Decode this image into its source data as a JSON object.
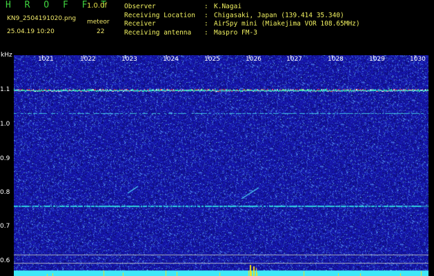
{
  "header": {
    "app_title": "H R O F F T",
    "version": "1.0.0f",
    "filename": "KN9_2504191020.png",
    "meteor_label": "meteor",
    "datetime": "25.04.19 10:20",
    "count": "22"
  },
  "info": [
    {
      "key": "Observer",
      "sep": ":",
      "value": "K.Nagai"
    },
    {
      "key": "Receiving Location",
      "sep": ":",
      "value": "Chigasaki, Japan (139.414 35.340)"
    },
    {
      "key": "Receiver",
      "sep": ":",
      "value": "AirSpy mini (Miakejima VOR 108.65MHz)"
    },
    {
      "key": "Receiving antenna",
      "sep": ":",
      "value": "Maspro FM-3"
    }
  ],
  "axis": {
    "y_unit": "kHz",
    "y_labels": [
      "1.1",
      "1.0",
      "0.9",
      "0.8",
      "0.7",
      "0.6"
    ],
    "x_labels": [
      "1021",
      "1022",
      "1023",
      "1024",
      "1025",
      "1026",
      "1027",
      "1028",
      "1029",
      "1030"
    ]
  },
  "colors": {
    "background": "#000000",
    "plot_base": "#1a1a9a",
    "title_green": "#3fd23f",
    "text_yellow": "#f0f060"
  }
}
